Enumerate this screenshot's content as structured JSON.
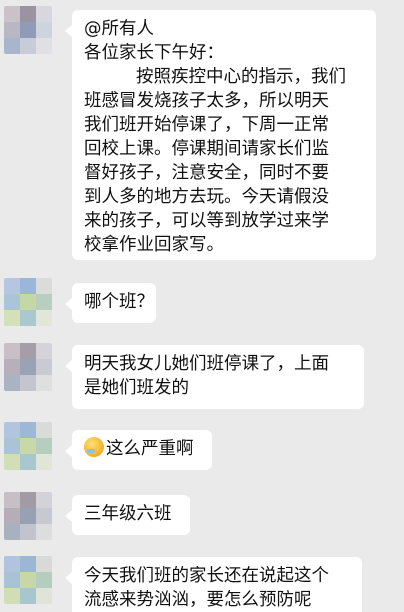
{
  "messages": [
    {
      "lines": [
        "@所有人",
        "各位家长下午好：",
        "按照疾控中心的指示，我们",
        "班感冒发烧孩子太多，所以明天",
        "我们班开始停课了，下周一正常",
        "回校上课。停课期间请家长们监",
        "督好孩子，注意安全，同时不要",
        "到人多的地方去玩。今天请假没",
        "来的孩子，可以等到放学过来学",
        "校拿作业回家写。"
      ]
    },
    {
      "lines": [
        "哪个班？"
      ]
    },
    {
      "lines": [
        "明天我女儿她们班停课了，上面",
        "是她们班发的"
      ]
    },
    {
      "lines": [
        "这么严重啊"
      ],
      "emoji": "crying-laughing-face-icon"
    },
    {
      "lines": [
        "三年级六班"
      ]
    },
    {
      "lines": [
        "今天我们班的家长还在说起这个",
        "流感来势汹汹，要怎么预防呢"
      ]
    }
  ],
  "colors": {
    "background": "#eaeaea",
    "bubble": "#ffffff"
  }
}
